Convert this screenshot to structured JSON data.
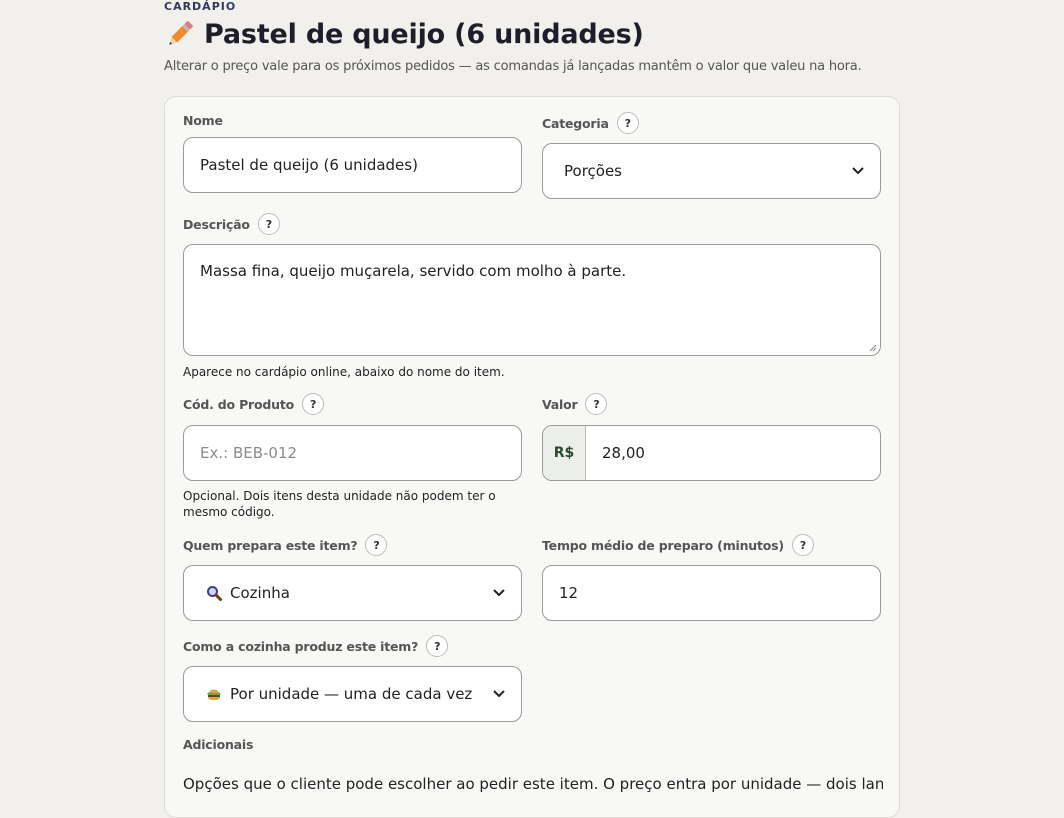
{
  "header": {
    "eyebrow": "CARDÁPIO",
    "title": "Pastel de queijo (6 unidades)",
    "subtitle": "Alterar o preço vale para os próximos pedidos — as comandas já lançadas mantêm o valor que valeu na hora."
  },
  "form": {
    "nome": {
      "label": "Nome",
      "value": "Pastel de queijo (6 unidades)"
    },
    "categoria": {
      "label": "Categoria",
      "help": "?",
      "value": "Porções"
    },
    "descricao": {
      "label": "Descrição",
      "help": "?",
      "value": "Massa fina, queijo muçarela, servido com molho à parte.",
      "hint": "Aparece no cardápio online, abaixo do nome do item."
    },
    "codigo": {
      "label": "Cód. do Produto",
      "help": "?",
      "placeholder": "Ex.: BEB-012",
      "hint_line1": "Opcional. Dois itens desta unidade não podem ter o",
      "hint_line2": "mesmo código."
    },
    "valor": {
      "label": "Valor",
      "help": "?",
      "prefix": "R$",
      "value": "28,00"
    },
    "quem_prepara": {
      "label": "Quem prepara este item?",
      "help": "?",
      "value": "Cozinha",
      "icon": "magnifier-icon"
    },
    "tempo": {
      "label": "Tempo médio de preparo (minutos)",
      "help": "?",
      "value": "12"
    },
    "como_produz": {
      "label": "Como a cozinha produz este item?",
      "help": "?",
      "value": "Por unidade — uma de cada vez",
      "icon": "burger-icon"
    },
    "adicionais": {
      "label": "Adicionais",
      "description": "Opções que o cliente pode escolher ao pedir este item. O preço entra por unidade — dois lanches"
    }
  },
  "colors": {
    "accent": "#e8713a",
    "page_bg": "#f1f0ed",
    "card_bg": "#f8f8f6"
  }
}
